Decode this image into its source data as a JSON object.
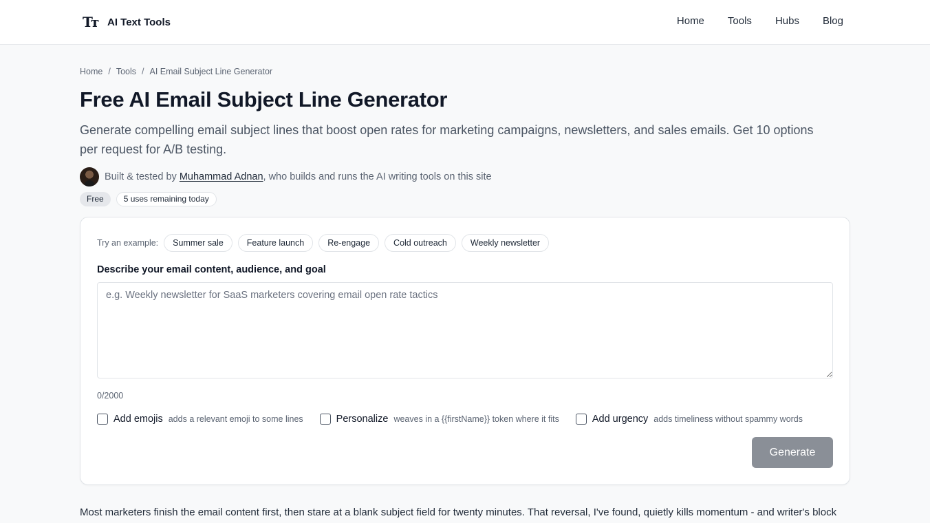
{
  "header": {
    "logo": "Tт",
    "brand": "AI Text Tools",
    "nav": [
      "Home",
      "Tools",
      "Hubs",
      "Blog"
    ]
  },
  "breadcrumb": {
    "items": [
      "Home",
      "Tools",
      "AI Email Subject Line Generator"
    ],
    "separator": "/"
  },
  "page": {
    "title": "Free AI Email Subject Line Generator",
    "lead": "Generate compelling email subject lines that boost open rates for marketing campaigns, newsletters, and sales emails. Get 10 options per request for A/B testing."
  },
  "author": {
    "prefix": "Built & tested by ",
    "name": "Muhammad Adnan",
    "suffix": ", who builds and runs the AI writing tools on this site"
  },
  "badges": {
    "free": "Free",
    "uses": "5 uses remaining today"
  },
  "form": {
    "examples_label": "Try an example:",
    "examples": [
      "Summer sale",
      "Feature launch",
      "Re-engage",
      "Cold outreach",
      "Weekly newsletter"
    ],
    "field_label": "Describe your email content, audience, and goal",
    "placeholder": "e.g. Weekly newsletter for SaaS marketers covering email open rate tactics",
    "value": "",
    "counter": "0/2000",
    "options": [
      {
        "label": "Add emojis",
        "hint": "adds a relevant emoji to some lines",
        "checked": false
      },
      {
        "label": "Personalize",
        "hint": "weaves in a {{firstName}} token where it fits",
        "checked": false
      },
      {
        "label": "Add urgency",
        "hint": "adds timeliness without spammy words",
        "checked": false
      }
    ],
    "generate_label": "Generate"
  },
  "content": {
    "intro": "Most marketers finish the email content first, then stare at a blank subject field for twenty minutes. That reversal, I've found, quietly kills momentum - and writer's block"
  },
  "colors": {
    "page_bg": "#f8f9fa",
    "button_disabled": "#8a8f97",
    "text_primary": "#111827",
    "text_muted": "#5b6472"
  }
}
